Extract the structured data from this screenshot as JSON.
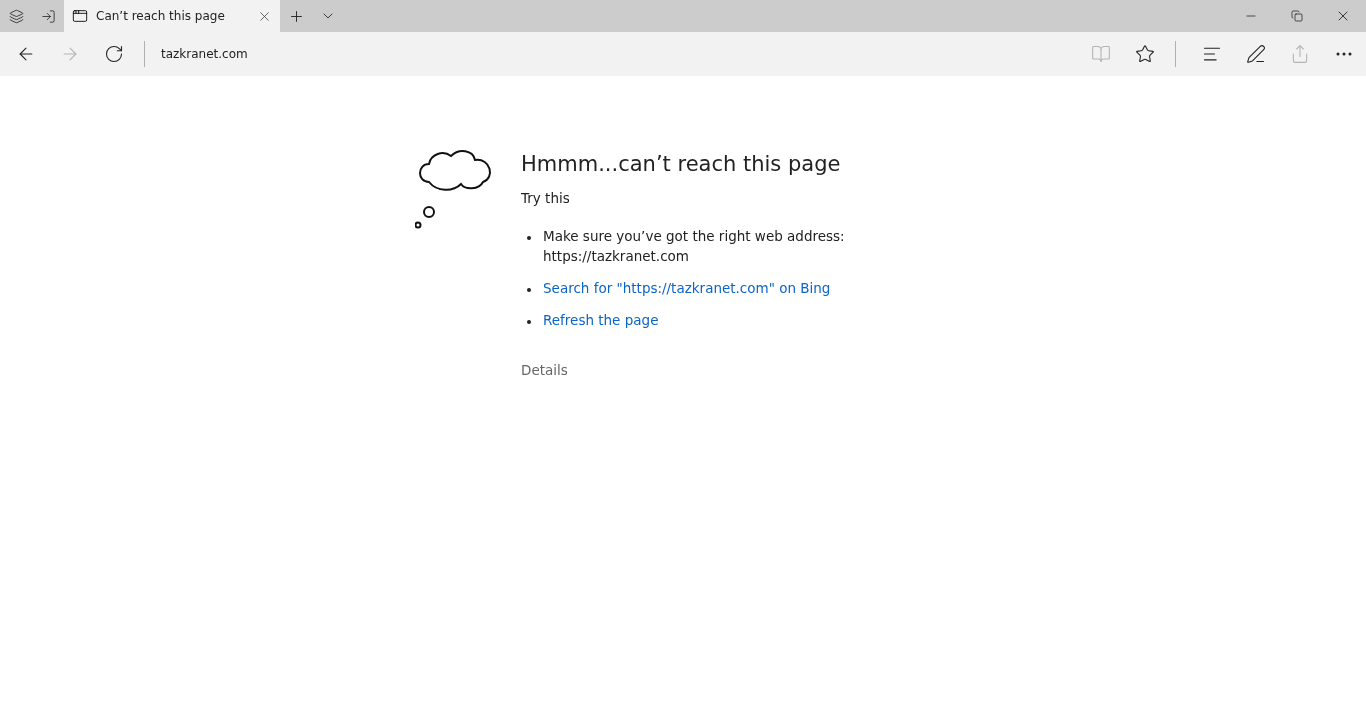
{
  "tab": {
    "title": "Can’t reach this page",
    "selected": true
  },
  "address": {
    "value": "tazkranet.com"
  },
  "nav_buttons": [
    {
      "kind": "back",
      "disabled": false
    },
    {
      "kind": "forward",
      "disabled": true
    },
    {
      "kind": "refresh",
      "disabled": false
    }
  ],
  "toolbar_buttons": [
    {
      "kind": "reading",
      "disabled": true
    },
    {
      "kind": "favorite",
      "disabled": false
    },
    {
      "kind": "hub",
      "disabled": false
    },
    {
      "kind": "note",
      "disabled": false
    },
    {
      "kind": "share",
      "disabled": true
    },
    {
      "kind": "more",
      "disabled": false
    }
  ],
  "error": {
    "heading": "Hmmm...can’t reach this page",
    "subheading": "Try this",
    "suggestions": [
      {
        "kind": "text",
        "text": "Make sure you’ve got the right web address:",
        "detail": "https://tazkranet.com"
      },
      {
        "kind": "link",
        "text": "Search for \"https://tazkranet.com\" on Bing"
      },
      {
        "kind": "link",
        "text": "Refresh the page"
      }
    ],
    "details": "Details"
  }
}
